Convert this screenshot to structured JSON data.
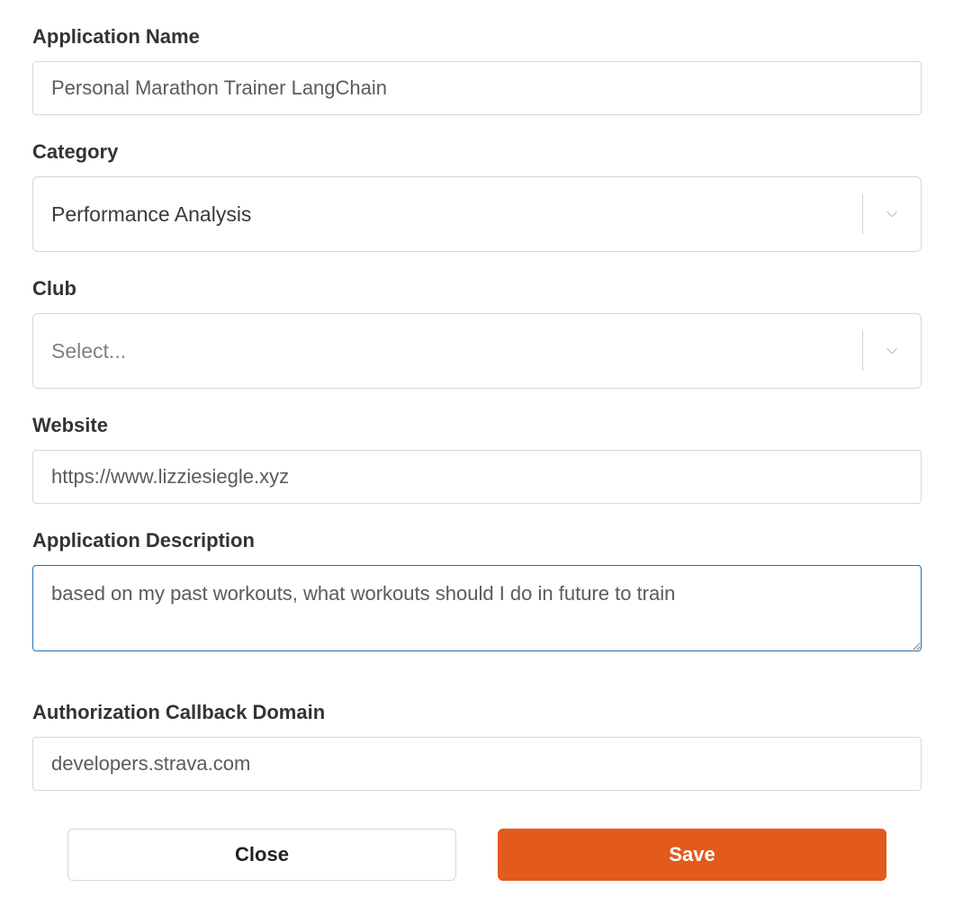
{
  "form": {
    "application_name": {
      "label": "Application Name",
      "value": "Personal Marathon Trainer LangChain"
    },
    "category": {
      "label": "Category",
      "selected": "Performance Analysis"
    },
    "club": {
      "label": "Club",
      "placeholder": "Select..."
    },
    "website": {
      "label": "Website",
      "value": "https://www.lizziesiegle.xyz"
    },
    "application_description": {
      "label": "Application Description",
      "value": "based on my past workouts, what workouts should I do in future to train"
    },
    "authorization_callback_domain": {
      "label": "Authorization Callback Domain",
      "value": "developers.strava.com"
    }
  },
  "buttons": {
    "close": "Close",
    "save": "Save"
  }
}
